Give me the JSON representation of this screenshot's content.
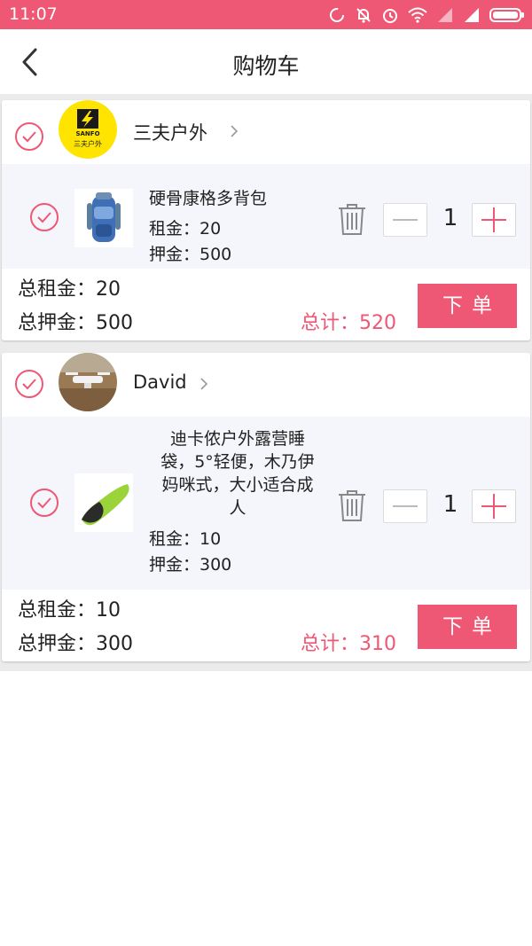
{
  "status_bar": {
    "time": "11:07",
    "icons": [
      "sync-icon",
      "bell-off-icon",
      "alarm-icon",
      "wifi-icon",
      "signal-icon",
      "signal-icon",
      "battery-icon"
    ]
  },
  "header": {
    "title": "购物车",
    "back_icon": "chevron-left-icon"
  },
  "colors": {
    "accent": "#ef5874",
    "background": "#ebebeb",
    "item_background": "#f4f6fb"
  },
  "stores": [
    {
      "name": "三夫户外",
      "avatar_logo_text": "SANFO 三夫户外",
      "checked": false,
      "items": [
        {
          "name": "硬骨康格多背包",
          "rent": "租金：20",
          "deposit": "押金：500",
          "quantity": "1",
          "checked": false,
          "thumbnail": "backpack-image"
        }
      ],
      "total_rent": "总租金：20",
      "total_deposit": "总押金：500",
      "total": "总计：520",
      "order_button": "下单"
    },
    {
      "name": "David",
      "avatar_logo_text": "",
      "checked": false,
      "items": [
        {
          "name_lines": [
            "迪卡侬户外露营睡",
            "袋，5°轻便，木乃伊",
            "妈咪式，大小适合成",
            "人"
          ],
          "rent": "租金：10",
          "deposit": "押金：300",
          "quantity": "1",
          "checked": false,
          "thumbnail": "sleeping-bag-image"
        }
      ],
      "total_rent": "总租金：10",
      "total_deposit": "总押金：300",
      "total": "总计：310",
      "order_button": "下单"
    }
  ]
}
